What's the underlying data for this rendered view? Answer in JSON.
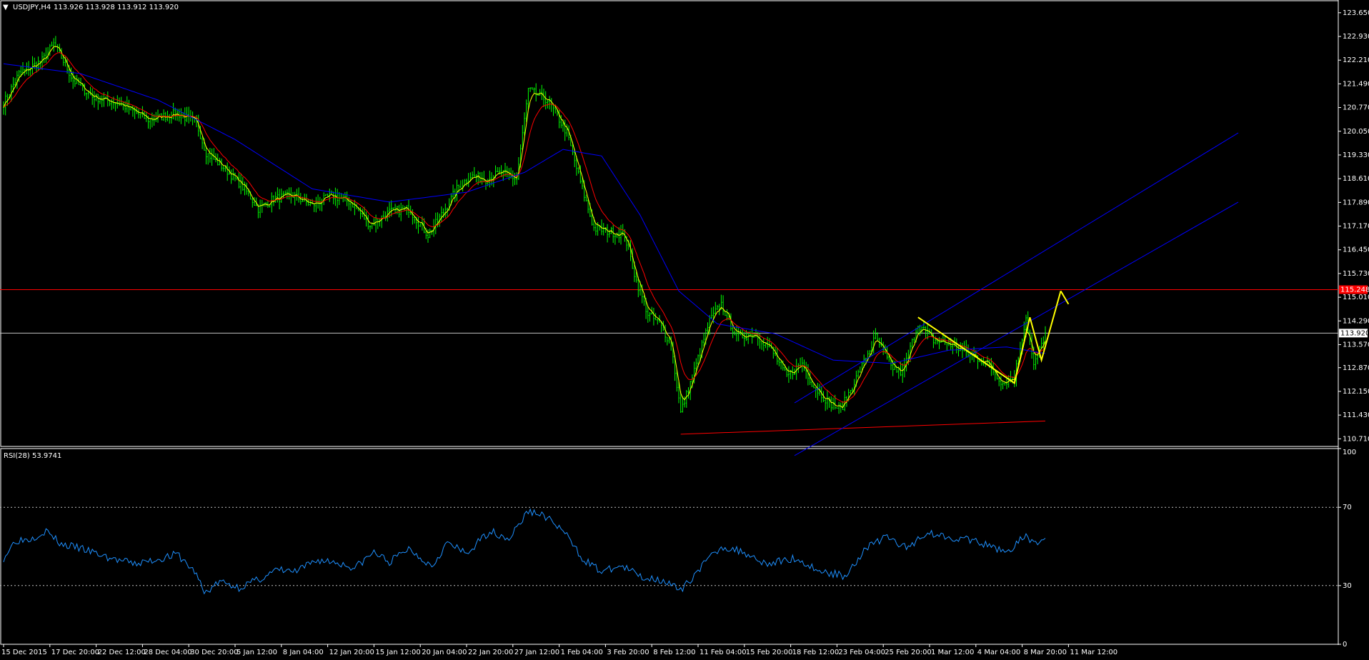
{
  "header": {
    "symbol_label": "USDJPY,H4",
    "ohlc_label": "113.926 113.928 113.912 113.920"
  },
  "rsi_header": {
    "label": "RSI(28) 53.9741"
  },
  "colors": {
    "background": "#000000",
    "candles": "#00ff00",
    "ma_fast": "#ffff00",
    "ma_mid": "#ff0000",
    "ma_slow": "#0000ff",
    "resistance": "#ff0000",
    "support": "#ff0000",
    "current_price_line": "#c0c0c0",
    "channel": "#0000ff",
    "pattern": "#ffff00",
    "rsi_line": "#1e90ff",
    "axis": "#ffffff",
    "grid_dotted": "#c0c0c0"
  },
  "chart_data": [
    {
      "type": "candlestick",
      "title": "USDJPY,H4",
      "timeframe": "H4",
      "ohlc_last": {
        "open": 113.926,
        "high": 113.928,
        "low": 113.912,
        "close": 113.92
      },
      "current_price": 113.92,
      "current_price_label": "113.920",
      "resistance_level": 115.24,
      "resistance_label": "115.248",
      "ylim": [
        110.5,
        123.95
      ],
      "yticks": [
        "123.650",
        "122.930",
        "122.210",
        "121.490",
        "120.770",
        "120.050",
        "119.330",
        "118.610",
        "117.890",
        "117.170",
        "116.450",
        "115.730",
        "115.010",
        "114.290",
        "113.570",
        "112.870",
        "112.150",
        "111.430",
        "110.710"
      ],
      "x_tick_labels": [
        "15 Dec 2015",
        "17 Dec 20:00",
        "22 Dec 12:00",
        "28 Dec 04:00",
        "30 Dec 20:00",
        "5 Jan 12:00",
        "8 Jan 04:00",
        "12 Jan 20:00",
        "15 Jan 12:00",
        "20 Jan 04:00",
        "22 Jan 20:00",
        "27 Jan 12:00",
        "1 Feb 04:00",
        "3 Feb 20:00",
        "8 Feb 12:00",
        "11 Feb 04:00",
        "15 Feb 20:00",
        "18 Feb 12:00",
        "23 Feb 04:00",
        "25 Feb 20:00",
        "1 Mar 12:00",
        "4 Mar 04:00",
        "8 Mar 20:00",
        "11 Mar 12:00"
      ],
      "close_path": [
        {
          "bar": 0,
          "close": 120.9
        },
        {
          "bar": 8,
          "close": 121.8
        },
        {
          "bar": 20,
          "close": 122.2
        },
        {
          "bar": 26,
          "close": 122.7
        },
        {
          "bar": 30,
          "close": 122.3
        },
        {
          "bar": 36,
          "close": 121.6
        },
        {
          "bar": 46,
          "close": 121.1
        },
        {
          "bar": 60,
          "close": 120.9
        },
        {
          "bar": 75,
          "close": 120.4
        },
        {
          "bar": 90,
          "close": 120.6
        },
        {
          "bar": 100,
          "close": 120.3
        },
        {
          "bar": 105,
          "close": 119.4
        },
        {
          "bar": 115,
          "close": 118.9
        },
        {
          "bar": 125,
          "close": 118.3
        },
        {
          "bar": 132,
          "close": 117.7
        },
        {
          "bar": 140,
          "close": 118.0
        },
        {
          "bar": 150,
          "close": 118.1
        },
        {
          "bar": 160,
          "close": 117.8
        },
        {
          "bar": 170,
          "close": 118.1
        },
        {
          "bar": 180,
          "close": 117.9
        },
        {
          "bar": 190,
          "close": 117.2
        },
        {
          "bar": 200,
          "close": 117.6
        },
        {
          "bar": 210,
          "close": 117.7
        },
        {
          "bar": 220,
          "close": 116.9
        },
        {
          "bar": 228,
          "close": 117.6
        },
        {
          "bar": 235,
          "close": 118.3
        },
        {
          "bar": 242,
          "close": 118.7
        },
        {
          "bar": 250,
          "close": 118.6
        },
        {
          "bar": 258,
          "close": 118.8
        },
        {
          "bar": 266,
          "close": 118.6
        },
        {
          "bar": 272,
          "close": 121.3
        },
        {
          "bar": 282,
          "close": 121.0
        },
        {
          "bar": 292,
          "close": 120.0
        },
        {
          "bar": 300,
          "close": 118.3
        },
        {
          "bar": 306,
          "close": 117.1
        },
        {
          "bar": 314,
          "close": 117.0
        },
        {
          "bar": 322,
          "close": 116.9
        },
        {
          "bar": 328,
          "close": 115.5
        },
        {
          "bar": 334,
          "close": 114.5
        },
        {
          "bar": 340,
          "close": 114.2
        },
        {
          "bar": 346,
          "close": 113.6
        },
        {
          "bar": 351,
          "close": 111.5
        },
        {
          "bar": 356,
          "close": 112.4
        },
        {
          "bar": 366,
          "close": 114.3
        },
        {
          "bar": 372,
          "close": 114.8
        },
        {
          "bar": 380,
          "close": 113.8
        },
        {
          "bar": 390,
          "close": 113.9
        },
        {
          "bar": 398,
          "close": 113.4
        },
        {
          "bar": 406,
          "close": 112.6
        },
        {
          "bar": 414,
          "close": 113.0
        },
        {
          "bar": 420,
          "close": 112.3
        },
        {
          "bar": 428,
          "close": 111.8
        },
        {
          "bar": 434,
          "close": 111.6
        },
        {
          "bar": 444,
          "close": 112.8
        },
        {
          "bar": 452,
          "close": 113.8
        },
        {
          "bar": 460,
          "close": 112.9
        },
        {
          "bar": 466,
          "close": 112.7
        },
        {
          "bar": 474,
          "close": 114.2
        },
        {
          "bar": 482,
          "close": 113.7
        },
        {
          "bar": 490,
          "close": 113.6
        },
        {
          "bar": 500,
          "close": 113.3
        },
        {
          "bar": 510,
          "close": 113.0
        },
        {
          "bar": 518,
          "close": 112.4
        },
        {
          "bar": 524,
          "close": 112.6
        },
        {
          "bar": 530,
          "close": 114.4
        },
        {
          "bar": 534,
          "close": 112.9
        },
        {
          "bar": 540,
          "close": 113.9
        }
      ],
      "ma_slow_path": [
        {
          "bar": 0,
          "value": 122.1
        },
        {
          "bar": 40,
          "value": 121.8
        },
        {
          "bar": 80,
          "value": 121.0
        },
        {
          "bar": 120,
          "value": 119.8
        },
        {
          "bar": 160,
          "value": 118.3
        },
        {
          "bar": 200,
          "value": 117.9
        },
        {
          "bar": 240,
          "value": 118.2
        },
        {
          "bar": 270,
          "value": 118.8
        },
        {
          "bar": 290,
          "value": 119.5
        },
        {
          "bar": 310,
          "value": 119.3
        },
        {
          "bar": 330,
          "value": 117.5
        },
        {
          "bar": 350,
          "value": 115.2
        },
        {
          "bar": 370,
          "value": 114.2
        },
        {
          "bar": 400,
          "value": 113.9
        },
        {
          "bar": 430,
          "value": 113.1
        },
        {
          "bar": 460,
          "value": 113.0
        },
        {
          "bar": 490,
          "value": 113.4
        },
        {
          "bar": 520,
          "value": 113.5
        },
        {
          "bar": 540,
          "value": 113.3
        }
      ],
      "trend_lines": {
        "support": [
          {
            "bar": 351,
            "price": 110.85
          },
          {
            "bar": 540,
            "price": 111.25
          }
        ],
        "channel_lower": [
          {
            "bar": 410,
            "price": 110.2
          },
          {
            "bar": 640,
            "price": 117.9
          }
        ],
        "channel_upper": [
          {
            "bar": 410,
            "price": 111.8
          },
          {
            "bar": 640,
            "price": 120.0
          }
        ],
        "pattern_zigzag": [
          {
            "bar": 474,
            "price": 114.4
          },
          {
            "bar": 524,
            "price": 112.4
          },
          {
            "bar": 532,
            "price": 114.4
          },
          {
            "bar": 538,
            "price": 113.1
          },
          {
            "bar": 548,
            "price": 115.2
          },
          {
            "bar": 552,
            "price": 114.8
          }
        ]
      }
    },
    {
      "type": "line",
      "title": "RSI(28) 53.9741",
      "ylim": [
        0,
        100
      ],
      "yticks": [
        "100",
        "70",
        "30",
        "0"
      ],
      "levels": [
        70,
        30
      ],
      "last_value": 53.9741,
      "values": [
        {
          "bar": 0,
          "value": 44
        },
        {
          "bar": 6,
          "value": 53
        },
        {
          "bar": 14,
          "value": 54
        },
        {
          "bar": 22,
          "value": 58
        },
        {
          "bar": 30,
          "value": 51
        },
        {
          "bar": 40,
          "value": 49
        },
        {
          "bar": 55,
          "value": 44
        },
        {
          "bar": 68,
          "value": 41
        },
        {
          "bar": 78,
          "value": 43
        },
        {
          "bar": 90,
          "value": 46
        },
        {
          "bar": 100,
          "value": 36
        },
        {
          "bar": 104,
          "value": 26
        },
        {
          "bar": 112,
          "value": 32
        },
        {
          "bar": 122,
          "value": 29
        },
        {
          "bar": 132,
          "value": 33
        },
        {
          "bar": 142,
          "value": 38
        },
        {
          "bar": 152,
          "value": 37
        },
        {
          "bar": 162,
          "value": 43
        },
        {
          "bar": 172,
          "value": 42
        },
        {
          "bar": 182,
          "value": 39
        },
        {
          "bar": 192,
          "value": 47
        },
        {
          "bar": 200,
          "value": 42
        },
        {
          "bar": 210,
          "value": 49
        },
        {
          "bar": 222,
          "value": 40
        },
        {
          "bar": 230,
          "value": 52
        },
        {
          "bar": 240,
          "value": 46
        },
        {
          "bar": 252,
          "value": 58
        },
        {
          "bar": 262,
          "value": 54
        },
        {
          "bar": 272,
          "value": 68
        },
        {
          "bar": 280,
          "value": 66
        },
        {
          "bar": 290,
          "value": 58
        },
        {
          "bar": 300,
          "value": 44
        },
        {
          "bar": 310,
          "value": 37
        },
        {
          "bar": 320,
          "value": 40
        },
        {
          "bar": 332,
          "value": 34
        },
        {
          "bar": 342,
          "value": 33
        },
        {
          "bar": 351,
          "value": 27
        },
        {
          "bar": 360,
          "value": 38
        },
        {
          "bar": 372,
          "value": 50
        },
        {
          "bar": 384,
          "value": 47
        },
        {
          "bar": 396,
          "value": 41
        },
        {
          "bar": 410,
          "value": 44
        },
        {
          "bar": 424,
          "value": 37
        },
        {
          "bar": 436,
          "value": 35
        },
        {
          "bar": 448,
          "value": 50
        },
        {
          "bar": 458,
          "value": 55
        },
        {
          "bar": 468,
          "value": 49
        },
        {
          "bar": 478,
          "value": 57
        },
        {
          "bar": 490,
          "value": 55
        },
        {
          "bar": 502,
          "value": 53
        },
        {
          "bar": 514,
          "value": 49
        },
        {
          "bar": 522,
          "value": 48
        },
        {
          "bar": 530,
          "value": 56
        },
        {
          "bar": 534,
          "value": 51
        },
        {
          "bar": 540,
          "value": 54
        }
      ]
    }
  ]
}
